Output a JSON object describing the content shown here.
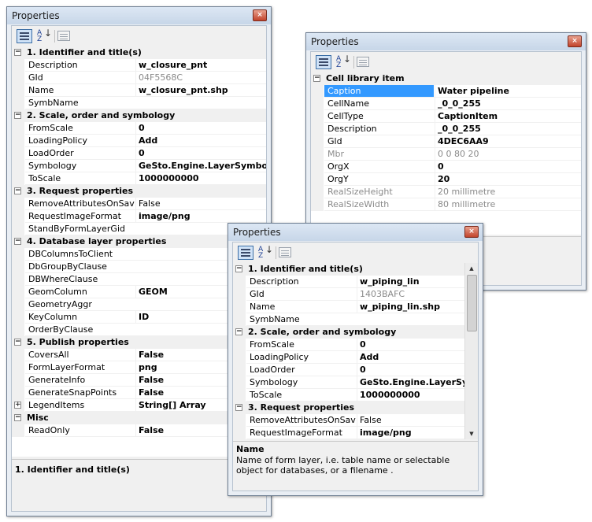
{
  "window1": {
    "title": "Properties",
    "rows": [
      {
        "type": "cat",
        "label": "1. Identifier and title(s)",
        "exp": "−"
      },
      {
        "name": "Description",
        "value": "w_closure_pnt",
        "bold": true
      },
      {
        "name": "GId",
        "value": "04F5568C",
        "gray": true
      },
      {
        "name": "Name",
        "value": "w_closure_pnt.shp",
        "bold": true
      },
      {
        "name": "SymbName",
        "value": ""
      },
      {
        "type": "cat",
        "label": "2. Scale, order and symbology",
        "exp": "−"
      },
      {
        "name": "FromScale",
        "value": "0",
        "bold": true
      },
      {
        "name": "LoadingPolicy",
        "value": "Add",
        "bold": true
      },
      {
        "name": "LoadOrder",
        "value": "0",
        "bold": true
      },
      {
        "name": "Symbology",
        "value": "GeSto.Engine.LayerSymbologyDescr",
        "bold": true
      },
      {
        "name": "ToScale",
        "value": "1000000000",
        "bold": true
      },
      {
        "type": "cat",
        "label": "3. Request properties",
        "exp": "−"
      },
      {
        "name": "RemoveAttributesOnSave",
        "value": "False"
      },
      {
        "name": "RequestImageFormat",
        "value": "image/png",
        "bold": true
      },
      {
        "name": "StandByFormLayerGid",
        "value": ""
      },
      {
        "type": "cat",
        "label": "4. Database layer properties",
        "exp": "−"
      },
      {
        "name": "DBColumnsToClient",
        "value": ""
      },
      {
        "name": "DbGroupByClause",
        "value": ""
      },
      {
        "name": "DBWhereClause",
        "value": ""
      },
      {
        "name": "GeomColumn",
        "value": "GEOM",
        "bold": true
      },
      {
        "name": "GeometryAggr",
        "value": ""
      },
      {
        "name": "KeyColumn",
        "value": "ID",
        "bold": true
      },
      {
        "name": "OrderByClause",
        "value": ""
      },
      {
        "type": "cat",
        "label": "5. Publish properties",
        "exp": "−"
      },
      {
        "name": "CoversAll",
        "value": "False",
        "bold": true
      },
      {
        "name": "FormLayerFormat",
        "value": "png",
        "bold": true
      },
      {
        "name": "GenerateInfo",
        "value": "False",
        "bold": true
      },
      {
        "name": "GenerateSnapPoints",
        "value": "False",
        "bold": true
      },
      {
        "name": "LegendItems",
        "value": "String[] Array",
        "bold": true,
        "exp": "+"
      },
      {
        "type": "cat",
        "label": "Misc",
        "exp": "−"
      },
      {
        "name": "ReadOnly",
        "value": "False",
        "bold": true
      }
    ],
    "description_title": "1. Identifier and title(s)",
    "description_text": ""
  },
  "window2": {
    "title": "Properties",
    "rows": [
      {
        "type": "cat",
        "label": "Cell library item",
        "exp": "−"
      },
      {
        "name": "Caption",
        "value": "Water pipeline",
        "bold": true,
        "selected": true
      },
      {
        "name": "CellName",
        "value": "_0_0_255",
        "bold": true
      },
      {
        "name": "CellType",
        "value": "CaptionItem",
        "bold": true
      },
      {
        "name": "Description",
        "value": "_0_0_255",
        "bold": true
      },
      {
        "name": "Gld",
        "value": "4DEC6AA9",
        "bold": true
      },
      {
        "name": "Mbr",
        "value": "0 0 80 20",
        "gray": true,
        "grayname": true
      },
      {
        "name": "OrgX",
        "value": "0",
        "bold": true
      },
      {
        "name": "OrgY",
        "value": "20",
        "bold": true
      },
      {
        "name": "RealSizeHeight",
        "value": "20 millimetre",
        "gray": true,
        "grayname": true
      },
      {
        "name": "RealSizeWidth",
        "value": "80 millimetre",
        "gray": true,
        "grayname": true
      }
    ]
  },
  "window3": {
    "title": "Properties",
    "rows": [
      {
        "type": "cat",
        "label": "1. Identifier and title(s)",
        "exp": "−"
      },
      {
        "name": "Description",
        "value": "w_piping_lin",
        "bold": true
      },
      {
        "name": "GId",
        "value": "1403BAFC",
        "gray": true
      },
      {
        "name": "Name",
        "value": "w_piping_lin.shp",
        "bold": true
      },
      {
        "name": "SymbName",
        "value": ""
      },
      {
        "type": "cat",
        "label": "2. Scale, order and symbology",
        "exp": "−"
      },
      {
        "name": "FromScale",
        "value": "0",
        "bold": true
      },
      {
        "name": "LoadingPolicy",
        "value": "Add",
        "bold": true
      },
      {
        "name": "LoadOrder",
        "value": "0",
        "bold": true
      },
      {
        "name": "Symbology",
        "value": "GeSto.Engine.LayerSymbologyDescr",
        "bold": true
      },
      {
        "name": "ToScale",
        "value": "1000000000",
        "bold": true
      },
      {
        "type": "cat",
        "label": "3. Request properties",
        "exp": "−"
      },
      {
        "name": "RemoveAttributesOnSave",
        "value": "False"
      },
      {
        "name": "RequestImageFormat",
        "value": "image/png",
        "bold": true
      }
    ],
    "description_title": "Name",
    "description_text": "Name of form layer, i.e. table name or selectable object for databases, or a filename ."
  },
  "icons": {
    "close": "×",
    "sort_az": "A\nZ",
    "sort_arrow": "↓",
    "scroll_up": "▲",
    "scroll_down": "▼"
  },
  "colors": {
    "selection": "#3399ff",
    "close_button": "#c2432b"
  }
}
